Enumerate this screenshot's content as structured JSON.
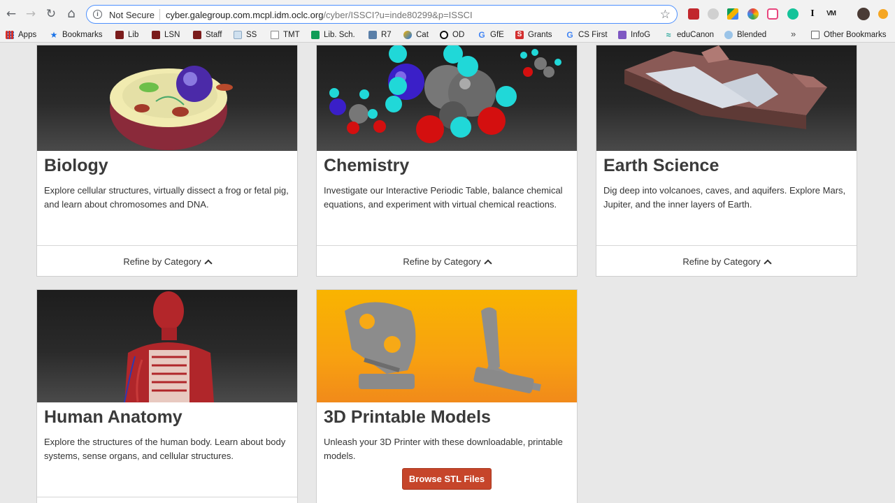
{
  "browser": {
    "security_label": "Not Secure",
    "url_host": "cyber.galegroup.com.mcpl.idm.oclc.org",
    "url_path": "/cyber/ISSCI?u=inde80299&p=ISSCI",
    "bookmarks": [
      "Apps",
      "Bookmarks",
      "Lib",
      "LSN",
      "Staff",
      "SS",
      "TMT",
      "Lib. Sch.",
      "R7",
      "Cat",
      "OD",
      "GfE",
      "Grants",
      "CS First",
      "InfoG",
      "eduCanon",
      "Blended"
    ],
    "overflow_label": "»",
    "other_bookmarks": "Other Bookmarks",
    "colors": {
      "omnibox_border": "#4d90fe",
      "chrome_bg": "#f2f2f2"
    }
  },
  "cards": [
    {
      "title": "Biology",
      "description": "Explore cellular structures, virtually dissect a frog or fetal pig, and learn about chromosomes and DNA.",
      "footer": "Refine by Category",
      "image": "animal-cell-model"
    },
    {
      "title": "Chemistry",
      "description": "Investigate our Interactive Periodic Table, balance chemical equations, and experiment with virtual chemical reactions.",
      "footer": "Refine by Category",
      "image": "molecule-models"
    },
    {
      "title": "Earth Science",
      "description": "Dig deep into volcanoes, caves, and aquifers. Explore Mars, Jupiter, and the inner layers of Earth.",
      "footer": "Refine by Category",
      "image": "glacier-terrain-model"
    },
    {
      "title": "Human Anatomy",
      "description": "Explore the structures of the human body. Learn about body systems, sense organs, and cellular structures.",
      "image": "human-torso-model"
    },
    {
      "title": "3D Printable Models",
      "description": "Unleash your 3D Printer with these downloadable, printable models.",
      "button": "Browse STL Files",
      "image": "printed-skull-and-foot-models"
    }
  ],
  "colors": {
    "page_bg": "#e8e8e8",
    "button_bg": "#c6452a",
    "title_text": "#3a3a3a"
  }
}
